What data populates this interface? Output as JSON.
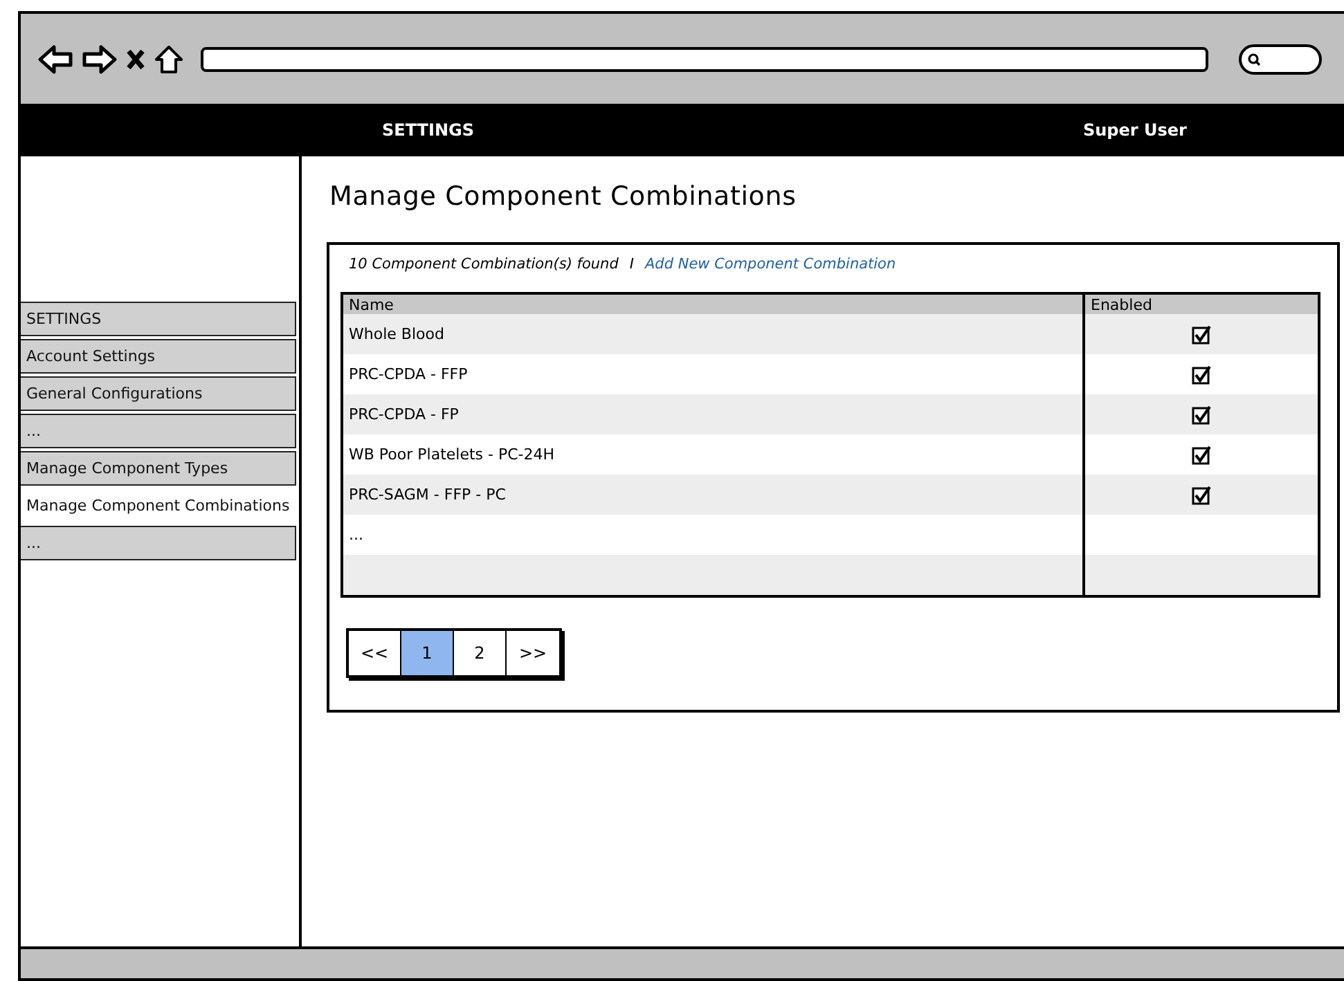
{
  "nav_bar": {
    "title": "SETTINGS",
    "user": "Super User"
  },
  "sidebar": {
    "items": [
      {
        "label": "SETTINGS",
        "selected": false
      },
      {
        "label": "Account Settings",
        "selected": false
      },
      {
        "label": "General Configurations",
        "selected": false
      },
      {
        "label": "...",
        "selected": false
      },
      {
        "label": "Manage Component Types",
        "selected": false
      },
      {
        "label": "Manage Component Combinations",
        "selected": true
      },
      {
        "label": "...",
        "selected": false
      }
    ]
  },
  "page": {
    "title": "Manage Component Combinations",
    "count_text": "10 Component Combination(s) found",
    "separator": "I",
    "add_link": "Add New Component Combination"
  },
  "table": {
    "columns": [
      "Name",
      "Enabled"
    ],
    "rows": [
      {
        "name": "Whole Blood",
        "enabled": true
      },
      {
        "name": "PRC-CPDA - FFP",
        "enabled": true
      },
      {
        "name": "PRC-CPDA - FP",
        "enabled": true
      },
      {
        "name": "WB Poor Platelets - PC-24H",
        "enabled": true
      },
      {
        "name": "PRC-SAGM - FFP - PC",
        "enabled": true
      },
      {
        "name": "..."
      }
    ]
  },
  "pagination": [
    {
      "label": "<<",
      "selected": false
    },
    {
      "label": "1",
      "selected": true
    },
    {
      "label": "2",
      "selected": false
    },
    {
      "label": ">>",
      "selected": false
    }
  ]
}
